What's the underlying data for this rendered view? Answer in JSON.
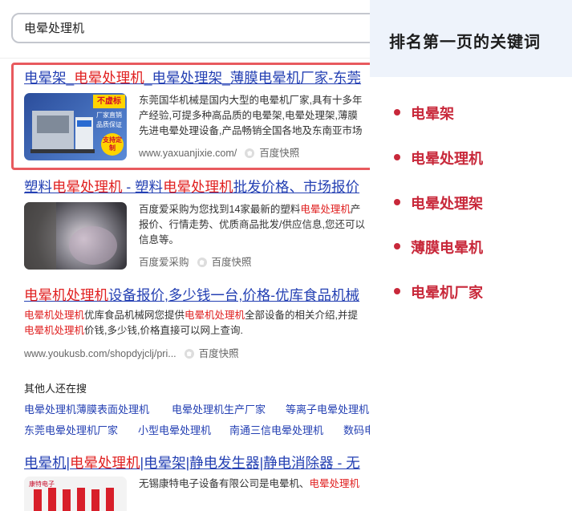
{
  "search": {
    "query": "电晕处理机"
  },
  "results": [
    {
      "title_parts": [
        {
          "text": "电晕架_",
          "hl": false
        },
        {
          "text": "电晕处理机",
          "hl": true
        },
        {
          "text": "_电晕处理架_薄膜电晕机厂家-东莞",
          "hl": false
        }
      ],
      "thumb_badge_top": "不虚标",
      "thumb_badge_list": [
        "厂家直销",
        "品质保证"
      ],
      "thumb_badge_round": "支持定制",
      "snippet_lines": [
        [
          {
            "text": "东莞国华机械是国内大型的电晕机厂家,具有十多年",
            "hl": false
          }
        ],
        [
          {
            "text": "产经验,可提多种高品质的电晕架,电晕处理架,薄膜",
            "hl": false
          }
        ],
        [
          {
            "text": "先进电晕处理设备,产品畅销全国各地及东南亚市场",
            "hl": false
          }
        ]
      ],
      "url": "www.yaxuanjixie.com/",
      "snapshot": "百度快照"
    },
    {
      "title_parts": [
        {
          "text": "塑料",
          "hl": false
        },
        {
          "text": "电晕处理机",
          "hl": true
        },
        {
          "text": " - 塑料",
          "hl": false
        },
        {
          "text": "电晕处理机",
          "hl": true
        },
        {
          "text": "批发价格、市场报价",
          "hl": false
        }
      ],
      "snippet_lines": [
        [
          {
            "text": "百度爱采购为您找到14家最新的塑料",
            "hl": false
          },
          {
            "text": "电晕处理机",
            "hl": true
          },
          {
            "text": "产",
            "hl": false
          }
        ],
        [
          {
            "text": "报价、行情走势、优质商品批发/供应信息,您还可以",
            "hl": false
          }
        ],
        [
          {
            "text": "信息等。",
            "hl": false
          }
        ]
      ],
      "source": "百度爱采购",
      "snapshot": "百度快照"
    },
    {
      "title_parts": [
        {
          "text": "电晕机处理机",
          "hl": true
        },
        {
          "text": "设备报价,多少钱一台,价格-优库食品机械",
          "hl": false
        }
      ],
      "snippet_lines": [
        [
          {
            "text": "电晕机处理机",
            "hl": true
          },
          {
            "text": "优库食品机械网您提供",
            "hl": false
          },
          {
            "text": "电晕机处理机",
            "hl": true
          },
          {
            "text": "全部设备的相关介绍,并提",
            "hl": false
          }
        ],
        [
          {
            "text": "电晕机处理机",
            "hl": true
          },
          {
            "text": "价钱,多少钱,价格直接可以网上查询.",
            "hl": false
          }
        ]
      ],
      "url": "www.youkusb.com/shopdyjclj/pri...",
      "snapshot": "百度快照"
    }
  ],
  "related": {
    "heading": "其他人还在搜",
    "row1": [
      "电晕处理机薄膜表面处理机",
      "电晕处理机生产厂家",
      "等离子电晕处理机"
    ],
    "row2": [
      "东莞电晕处理机厂家",
      "小型电晕处理机",
      "南通三信电晕处理机",
      "数码电"
    ]
  },
  "result4": {
    "title_parts": [
      {
        "text": "电晕机|",
        "hl": false
      },
      {
        "text": "电晕处理机",
        "hl": true
      },
      {
        "text": "|电晕架|静电发生器|静电消除器 - 无",
        "hl": false
      }
    ],
    "thumb_text": "康特电子",
    "snippet_parts": [
      {
        "text": "无锡康特电子设备有限公司是电晕机、",
        "hl": false
      },
      {
        "text": "电晕处理机",
        "hl": true
      }
    ]
  },
  "panel": {
    "title": "排名第一页的关键词",
    "keywords": [
      "电晕架",
      "电晕处理机",
      "电晕处理架",
      "薄膜电晕机",
      "电晕机厂家"
    ]
  },
  "colors": {
    "link": "#2440b3",
    "highlight": "#e02020",
    "keyword": "#c8283a",
    "panel_bg": "#eef3fb"
  }
}
